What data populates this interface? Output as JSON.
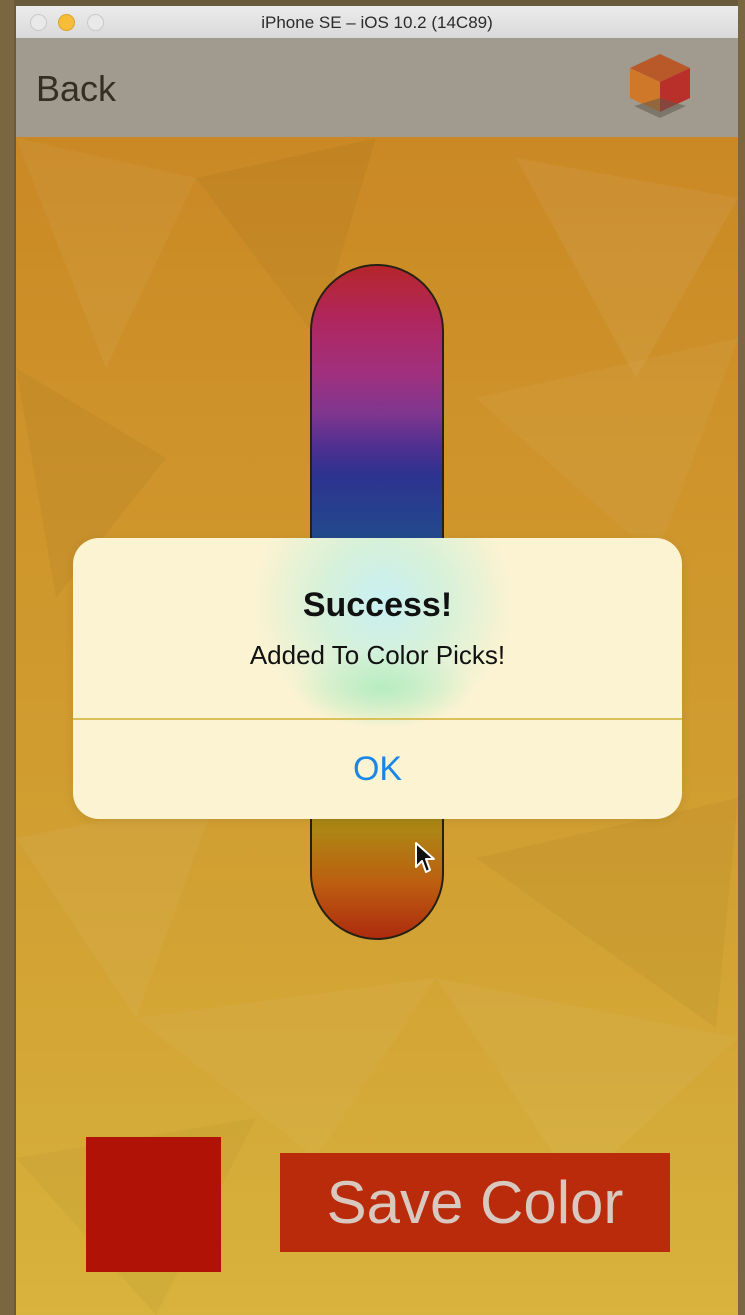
{
  "window": {
    "title": "iPhone SE – iOS 10.2 (14C89)",
    "controls": [
      "close",
      "minimize",
      "zoom"
    ]
  },
  "navbar": {
    "back_label": "Back",
    "logo_icon": "cube-logo-icon"
  },
  "slider": {
    "type": "color-spectrum-slider"
  },
  "alert": {
    "title": "Success!",
    "message": "Added To Color Picks!",
    "ok_label": "OK"
  },
  "footer": {
    "selected_color": "#b01205",
    "save_label": "Save Color"
  },
  "colors": {
    "accent": "#1a86e8",
    "navbar": "#a5a5a5",
    "save_button": "#b92b0b"
  }
}
